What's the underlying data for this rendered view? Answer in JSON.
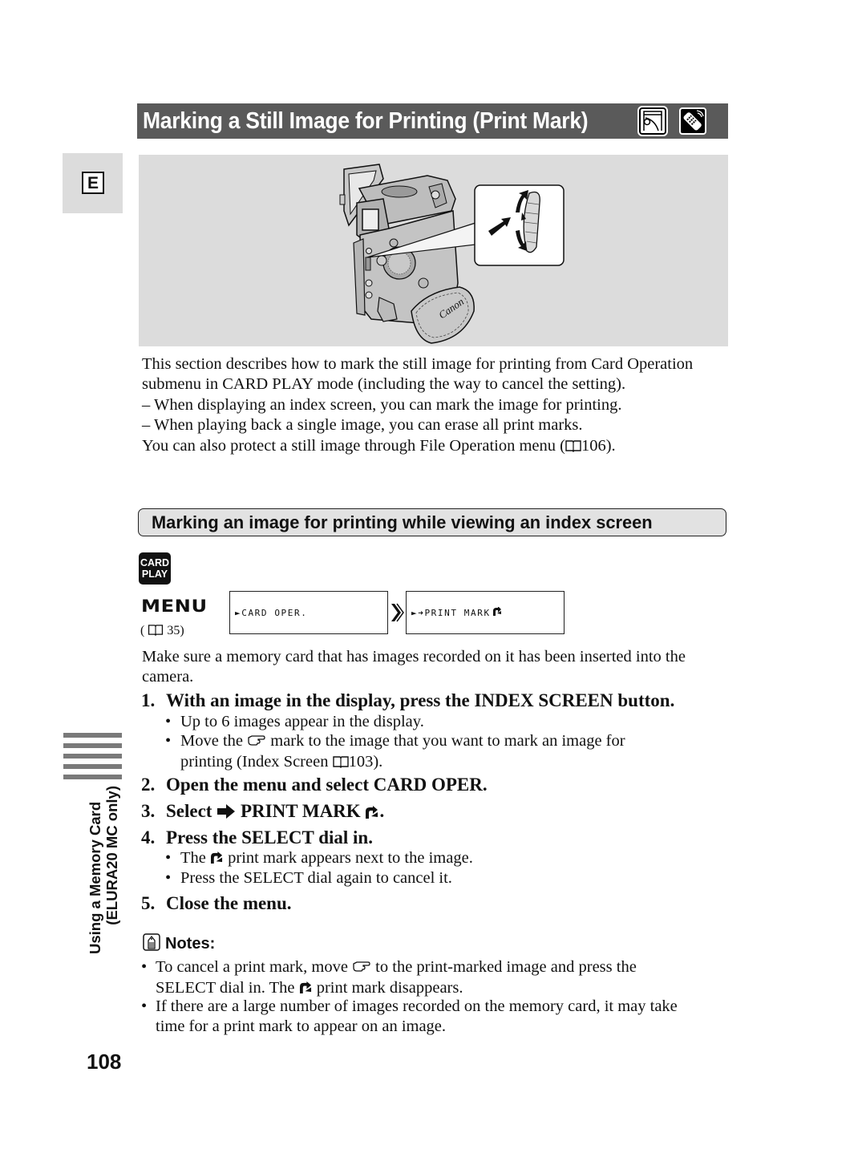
{
  "header": {
    "title": "Marking a Still Image for Printing (Print Mark)",
    "icons": [
      "card-mode-icon",
      "remote-control-icon"
    ]
  },
  "language_tab": "E",
  "illustration": {
    "description": "Camcorder with SELECT dial callout",
    "brand_label": "Canon"
  },
  "intro": {
    "paragraph": "This section describes how to mark the still image for printing from Card Operation submenu in CARD PLAY mode (including the way to cancel the setting).",
    "dash_items": [
      "– When displaying an index screen, you can mark the image for printing.",
      "– When playing back a single image, you can erase all print marks."
    ],
    "protect_prefix": "You can also protect a still image through File Operation menu (",
    "protect_ref": "106).",
    "protect_ref_icon": "book-icon"
  },
  "section": {
    "title": "Marking an image for printing while viewing an index screen",
    "mode_badge": [
      "CARD",
      "PLAY"
    ],
    "menu_label": "MENU",
    "menu_ref_open": "(",
    "menu_ref_page": "35)",
    "menu_path": [
      {
        "text": "►CARD OPER."
      },
      {
        "text": "►➜PRINT MARK"
      }
    ],
    "prerequisite": "Make sure a memory card that has images recorded on it has been inserted into the camera."
  },
  "steps": [
    {
      "number": "1.",
      "text": "With an image in the display, press the INDEX SCREEN button.",
      "bullets": [
        {
          "text": "Up to 6 images appear in the display."
        },
        {
          "before": "Move the",
          "icon": "pointing-hand-icon",
          "after": "mark to the image that you want to mark an image for",
          "cont": "printing (Index Screen",
          "ref": "103)."
        }
      ]
    },
    {
      "number": "2.",
      "text": "Open the menu and select CARD OPER."
    },
    {
      "number": "3.",
      "before": "Select",
      "icon": "arrow-right-icon",
      "text": "PRINT MARK",
      "after": "."
    },
    {
      "number": "4.",
      "text": "Press the SELECT dial in.",
      "bullets": [
        {
          "before": "The",
          "icon": "print-mark-icon",
          "after": "print mark appears next to the image."
        },
        {
          "text": "Press the SELECT dial again to cancel it."
        }
      ]
    },
    {
      "number": "5.",
      "text": "Close the menu."
    }
  ],
  "notes": {
    "title": "Notes:",
    "items": [
      {
        "before": "To cancel a print mark, move",
        "icon": "pointing-hand-icon",
        "after": "to the print-marked image and press the",
        "cont_before": "SELECT dial in. The",
        "cont_icon": "print-mark-icon",
        "cont_after": "print mark disappears."
      },
      {
        "text": "If there are a large number of images recorded on the memory card, it may take",
        "cont": "time for a print mark to appear on an image."
      }
    ]
  },
  "side_index": {
    "line1": "Using a Memory Card",
    "line2": "(ELURA20 MC only)"
  },
  "page_number": "108",
  "colors": {
    "title_bar": "#5a5a5a",
    "illustration_bg": "#dcdcdc",
    "section_header_bg": "#e2e2e2",
    "side_bars": "#7a7a7a"
  }
}
